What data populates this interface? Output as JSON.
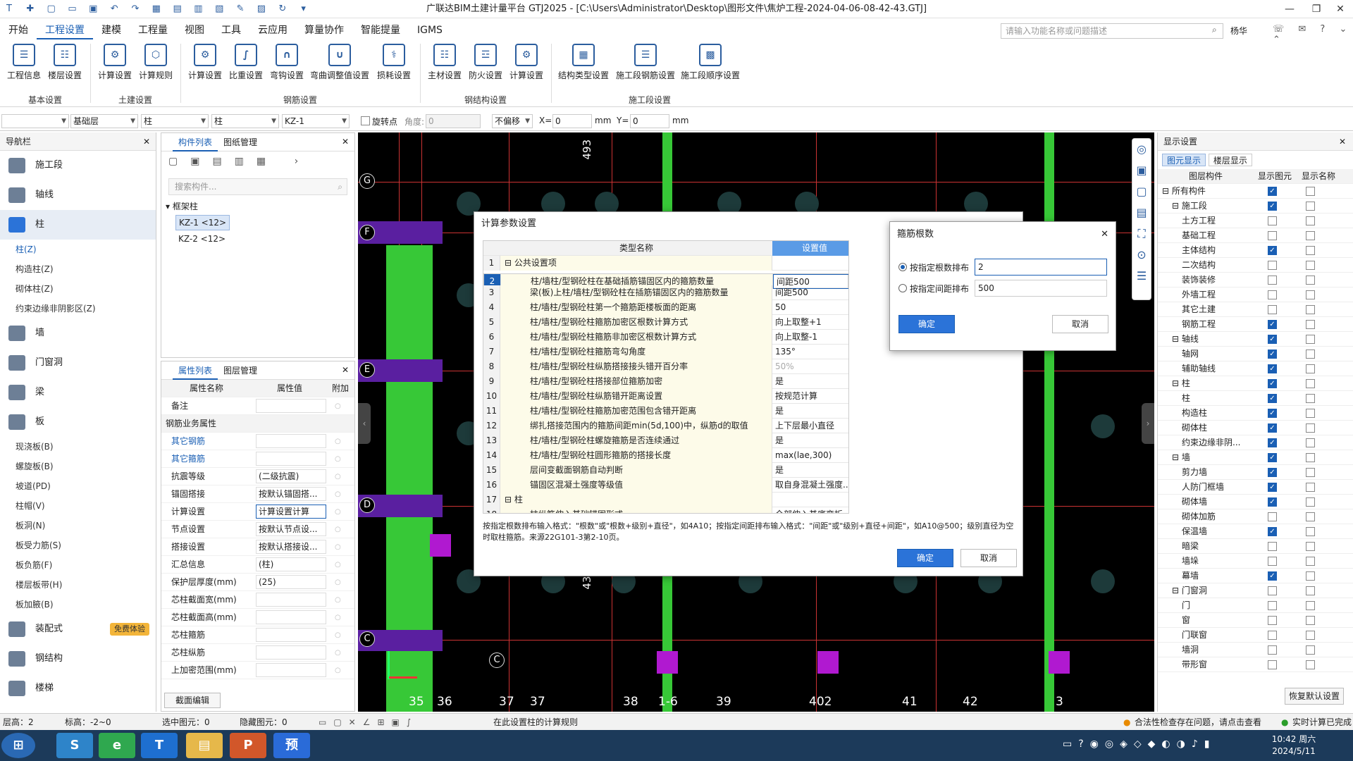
{
  "titlebar": {
    "title": "广联达BIM土建计量平台 GTJ2025 - [C:\\Users\\Administrator\\Desktop\\图形文件\\焦炉工程-2024-04-06-08-42-43.GTJ]"
  },
  "menu": [
    "开始",
    "工程设置",
    "建模",
    "工程量",
    "视图",
    "工具",
    "云应用",
    "算量协作",
    "智能提量",
    "IGMS"
  ],
  "search_placeholder": "请输入功能名称或问题描述",
  "user": "杨华",
  "ribbon": {
    "buttons": [
      "工程信息",
      "楼层设置",
      "计算设置",
      "计算规则",
      "计算设置",
      "比重设置",
      "弯钩设置",
      "弯曲调整值设置",
      "损耗设置",
      "主材设置",
      "防火设置",
      "计算设置",
      "结构类型设置",
      "施工段钢筋设置",
      "施工段顺序设置"
    ],
    "groups": [
      "基本设置",
      "土建设置",
      "钢筋设置",
      "钢结构设置",
      "施工段设置"
    ]
  },
  "toolbar2": {
    "selects": [
      "",
      "基础层",
      "柱",
      "柱",
      "KZ-1"
    ],
    "rotate_label": "旋转点",
    "angle_label": "角度:",
    "angle_value": "0",
    "offset": "不偏移",
    "x_label": "X=",
    "x_value": "0",
    "y_label": "Y=",
    "y_value": "0",
    "unit": "mm"
  },
  "nav": {
    "title": "导航栏",
    "main_items": [
      "施工段",
      "轴线",
      "柱",
      "墙",
      "门窗洞",
      "梁",
      "板",
      "装配式",
      "钢结构",
      "楼梯"
    ],
    "sub_col": [
      "柱(Z)",
      "构造柱(Z)",
      "砌体柱(Z)",
      "约束边缘非阴影区(Z)"
    ],
    "sub_slab": [
      "现浇板(B)",
      "螺旋板(B)",
      "坡道(PD)",
      "柱帽(V)",
      "板洞(N)",
      "板受力筋(S)",
      "板负筋(F)",
      "楼层板带(H)",
      "板加腋(B)"
    ],
    "free_badge": "免费体验"
  },
  "comp_panel": {
    "tabs": [
      "构件列表",
      "图纸管理"
    ],
    "search_placeholder": "搜索构件...",
    "tree_root": "框架柱",
    "items": [
      "KZ-1 <12>",
      "KZ-2 <12>"
    ]
  },
  "prop_panel": {
    "tabs": [
      "属性列表",
      "图层管理"
    ],
    "headers": [
      "属性名称",
      "属性值",
      "附加"
    ],
    "rows": [
      {
        "name": "备注",
        "value": ""
      },
      {
        "name": "钢筋业务属性",
        "value": ""
      },
      {
        "name": "其它钢筋",
        "value": ""
      },
      {
        "name": "其它箍筋",
        "value": ""
      },
      {
        "name": "抗震等级",
        "value": "(二级抗震)"
      },
      {
        "name": "锚固搭接",
        "value": "按默认锚固搭..."
      },
      {
        "name": "计算设置",
        "value": "计算设置计算"
      },
      {
        "name": "节点设置",
        "value": "按默认节点设..."
      },
      {
        "name": "搭接设置",
        "value": "按默认搭接设..."
      },
      {
        "name": "汇总信息",
        "value": "(柱)"
      },
      {
        "name": "保护层厚度(mm)",
        "value": "(25)"
      },
      {
        "name": "芯柱截面宽(mm)",
        "value": ""
      },
      {
        "name": "芯柱截面高(mm)",
        "value": ""
      },
      {
        "name": "芯柱箍筋",
        "value": ""
      },
      {
        "name": "芯柱纵筋",
        "value": ""
      },
      {
        "name": "上加密范围(mm)",
        "value": ""
      }
    ],
    "edit_btn": "截面编辑"
  },
  "canvas": {
    "row_axes": [
      "G",
      "F",
      "E",
      "D",
      "C"
    ],
    "col_axes": [
      "35",
      "36",
      "37",
      "37",
      "38",
      "1-6",
      "39",
      "402",
      "41",
      "42",
      "3"
    ],
    "dims": [
      "493",
      "437"
    ],
    "c_label": "C"
  },
  "display_panel": {
    "title": "显示设置",
    "tabs": [
      "图元显示",
      "楼层显示"
    ],
    "headers": [
      "图层构件",
      "显示图元",
      "显示名称"
    ],
    "rows": [
      {
        "name": "所有构件",
        "show": true,
        "name_show": false,
        "lvl": 0
      },
      {
        "name": "施工段",
        "show": true,
        "name_show": false,
        "lvl": 1
      },
      {
        "name": "土方工程",
        "show": false,
        "name_show": false,
        "lvl": 2
      },
      {
        "name": "基础工程",
        "show": false,
        "name_show": false,
        "lvl": 2
      },
      {
        "name": "主体结构",
        "show": true,
        "name_show": false,
        "lvl": 2
      },
      {
        "name": "二次结构",
        "show": false,
        "name_show": false,
        "lvl": 2
      },
      {
        "name": "装饰装修",
        "show": false,
        "name_show": false,
        "lvl": 2
      },
      {
        "name": "外墙工程",
        "show": false,
        "name_show": false,
        "lvl": 2
      },
      {
        "name": "其它土建",
        "show": false,
        "name_show": false,
        "lvl": 2
      },
      {
        "name": "钢筋工程",
        "show": true,
        "name_show": false,
        "lvl": 2
      },
      {
        "name": "轴线",
        "show": true,
        "name_show": false,
        "lvl": 1
      },
      {
        "name": "轴网",
        "show": true,
        "name_show": false,
        "lvl": 2
      },
      {
        "name": "辅助轴线",
        "show": true,
        "name_show": false,
        "lvl": 2
      },
      {
        "name": "柱",
        "show": true,
        "name_show": false,
        "lvl": 1
      },
      {
        "name": "柱",
        "show": true,
        "name_show": false,
        "lvl": 2
      },
      {
        "name": "构造柱",
        "show": true,
        "name_show": false,
        "lvl": 2
      },
      {
        "name": "砌体柱",
        "show": true,
        "name_show": false,
        "lvl": 2
      },
      {
        "name": "约束边缘非阴...",
        "show": true,
        "name_show": false,
        "lvl": 2
      },
      {
        "name": "墙",
        "show": true,
        "name_show": false,
        "lvl": 1
      },
      {
        "name": "剪力墙",
        "show": true,
        "name_show": false,
        "lvl": 2
      },
      {
        "name": "人防门框墙",
        "show": true,
        "name_show": false,
        "lvl": 2
      },
      {
        "name": "砌体墙",
        "show": true,
        "name_show": false,
        "lvl": 2
      },
      {
        "name": "砌体加筋",
        "show": false,
        "name_show": false,
        "lvl": 2
      },
      {
        "name": "保温墙",
        "show": true,
        "name_show": false,
        "lvl": 2
      },
      {
        "name": "暗梁",
        "show": false,
        "name_show": false,
        "lvl": 2
      },
      {
        "name": "墙垛",
        "show": false,
        "name_show": false,
        "lvl": 2
      },
      {
        "name": "幕墙",
        "show": true,
        "name_show": false,
        "lvl": 2
      },
      {
        "name": "门窗洞",
        "show": false,
        "name_show": false,
        "lvl": 1
      },
      {
        "name": "门",
        "show": false,
        "name_show": false,
        "lvl": 2
      },
      {
        "name": "窗",
        "show": false,
        "name_show": false,
        "lvl": 2
      },
      {
        "name": "门联窗",
        "show": false,
        "name_show": false,
        "lvl": 2
      },
      {
        "name": "墙洞",
        "show": false,
        "name_show": false,
        "lvl": 2
      },
      {
        "name": "带形窗",
        "show": false,
        "name_show": false,
        "lvl": 2
      }
    ],
    "restore_btn": "恢复默认设置"
  },
  "calc_dialog": {
    "title": "计算参数设置",
    "col_name": "类型名称",
    "col_value": "设置值",
    "rows": [
      {
        "no": "1",
        "name": "公共设置项",
        "value": "",
        "group": true
      },
      {
        "no": "2",
        "name": "柱/墙柱/型钢砼柱在基础插筋锚固区内的箍筋数量",
        "value": "间距500"
      },
      {
        "no": "3",
        "name": "梁(板)上柱/墙柱/型钢砼柱在插筋锚固区内的箍筋数量",
        "value": "间距500"
      },
      {
        "no": "4",
        "name": "柱/墙柱/型钢砼柱第一个箍筋距楼板面的距离",
        "value": "50"
      },
      {
        "no": "5",
        "name": "柱/墙柱/型钢砼柱箍筋加密区根数计算方式",
        "value": "向上取整+1"
      },
      {
        "no": "6",
        "name": "柱/墙柱/型钢砼柱箍筋非加密区根数计算方式",
        "value": "向上取整-1"
      },
      {
        "no": "7",
        "name": "柱/墙柱/型钢砼柱箍筋弯勾角度",
        "value": "135°"
      },
      {
        "no": "8",
        "name": "柱/墙柱/型钢砼柱纵筋搭接接头错开百分率",
        "value": "50%"
      },
      {
        "no": "9",
        "name": "柱/墙柱/型钢砼柱搭接部位箍筋加密",
        "value": "是"
      },
      {
        "no": "10",
        "name": "柱/墙柱/型钢砼柱纵筋错开距离设置",
        "value": "按规范计算"
      },
      {
        "no": "11",
        "name": "柱/墙柱/型钢砼柱箍筋加密范围包含错开距离",
        "value": "是"
      },
      {
        "no": "12",
        "name": "绑扎搭接范围内的箍筋间距min(5d,100)中，纵筋d的取值",
        "value": "上下层最小直径"
      },
      {
        "no": "13",
        "name": "柱/墙柱/型钢砼柱螺旋箍筋是否连续通过",
        "value": "是"
      },
      {
        "no": "14",
        "name": "柱/墙柱/型钢砼柱圆形箍筋的搭接长度",
        "value": "max(lae,300)"
      },
      {
        "no": "15",
        "name": "层间变截面钢筋自动判断",
        "value": "是"
      },
      {
        "no": "16",
        "name": "锚固区混凝土强度等级值",
        "value": "取自身混凝土强度..."
      },
      {
        "no": "17",
        "name": "柱",
        "value": "",
        "group": true
      },
      {
        "no": "18",
        "name": "柱纵筋伸入基础锚固形式",
        "value": "全部伸入基底弯折"
      }
    ],
    "hint": "按指定根数排布输入格式：\"根数\"或\"根数+级别+直径\"，如4A10；按指定间距排布输入格式：\"间距\"或\"级别+直径+间距\"，如A10@500；级别直径为空时取柱箍筋。来源22G101-3第2-10页。",
    "ok": "确定",
    "cancel": "取消"
  },
  "stirrup_dialog": {
    "title": "箍筋根数",
    "opt1": "按指定根数排布",
    "opt1_value": "2",
    "opt2": "按指定间距排布",
    "opt2_value": "500",
    "ok": "确定",
    "cancel": "取消"
  },
  "status": {
    "floor": "层高：2",
    "elev": "标高：-2~0",
    "selected": "选中图元：0",
    "hidden": "隐藏图元：0",
    "hint": "在此设置柱的计算规则",
    "check": "合法性检查存在问题，请点击查看",
    "calc": "实时计算已完成"
  },
  "taskbar": {
    "time": "10:42 周六",
    "date": "2024/5/11"
  }
}
